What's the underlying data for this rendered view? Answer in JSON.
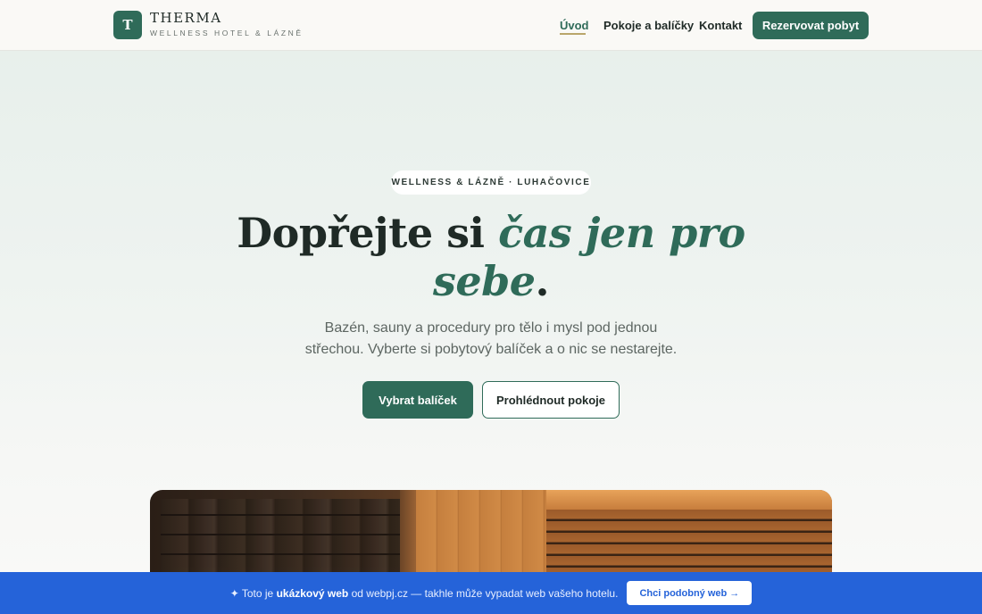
{
  "header": {
    "logo_letter": "T",
    "brand_name": "THERMA",
    "brand_tagline": "WELLNESS HOTEL & LÁZNĚ",
    "nav": {
      "home": "Úvod",
      "rooms": "Pokoje a balíčky",
      "contact": "Kontakt"
    },
    "reserve_label": "Rezervovat pobyt"
  },
  "hero": {
    "eyebrow": "WELLNESS & LÁZNĚ · LUHAČOVICE",
    "headline_start": "Dopřejte si ",
    "headline_emphasis": "čas jen pro sebe",
    "headline_end": ".",
    "subtitle": "Bazén, sauny a procedury pro tělo i mysl pod jednou střechou. Vyberte si pobytový balíček a o nic se nestarejte.",
    "primary_cta": "Vybrat balíček",
    "secondary_cta": "Prohlédnout pokoje"
  },
  "banner": {
    "icon": "✦",
    "text_before": " Toto je ",
    "text_bold": "ukázkový web",
    "text_after": " od webpj.cz — takhle může vypadat web vašeho hotelu.",
    "button_label": "Chci podobný web →"
  },
  "colors": {
    "accent": "#2f6b59",
    "banner": "#2563d9",
    "nav_underline": "#b9a66b"
  }
}
